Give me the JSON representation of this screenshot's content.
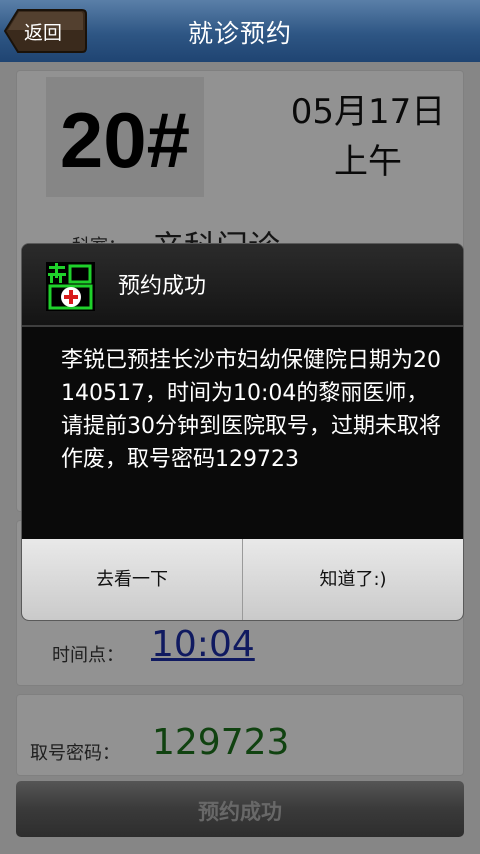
{
  "header": {
    "back_label": "返回",
    "title": "就诊预约"
  },
  "appointment": {
    "number": "20#",
    "date": "05月17日",
    "period": "上午",
    "department_label": "科室：",
    "department_value": "产科门诊",
    "doctor_value": "黎丽",
    "time_label": "时间点：",
    "time_value": "10:04",
    "code_label": "取号密码：",
    "code_value": "129723",
    "submit_label": "预约成功"
  },
  "dialog": {
    "title": "预约成功",
    "message": "李锐已预挂长沙市妇幼保健院日期为20140517，时间为10:04的黎丽医师，请提前30分钟到医院取号，过期未取将作废，取号密码129723",
    "left_button": "去看一下",
    "right_button": "知道了:)"
  },
  "colors": {
    "header": "#2e5684",
    "time_link": "#1a2a9c",
    "code_text": "#1b6b1b",
    "icon_green": "#1fd12b",
    "icon_red": "#d81b1b"
  },
  "icons": [
    "back-arrow-icon",
    "app-logo-icon"
  ]
}
